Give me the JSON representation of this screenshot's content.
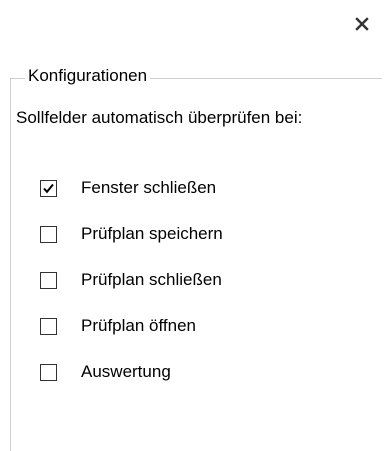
{
  "dialog": {
    "close_icon": "close-icon"
  },
  "group": {
    "title": "Konfigurationen",
    "description": "Sollfelder automatisch überprüfen bei:"
  },
  "options": [
    {
      "label": "Fenster schließen",
      "checked": true
    },
    {
      "label": "Prüfplan speichern",
      "checked": false
    },
    {
      "label": "Prüfplan schließen",
      "checked": false
    },
    {
      "label": "Prüfplan öffnen",
      "checked": false
    },
    {
      "label": "Auswertung",
      "checked": false
    }
  ]
}
